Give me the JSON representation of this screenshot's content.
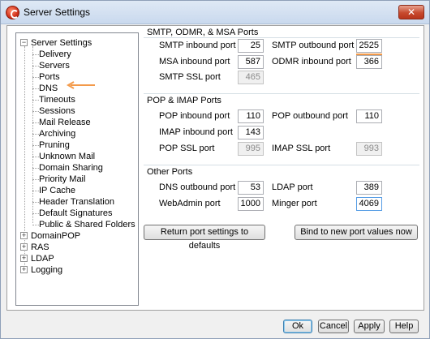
{
  "window": {
    "title": "Server Settings"
  },
  "tree": {
    "items": [
      {
        "label": "Server Settings",
        "level": 0,
        "expander": "−"
      },
      {
        "label": "Delivery",
        "level": 1
      },
      {
        "label": "Servers",
        "level": 1
      },
      {
        "label": "Ports",
        "level": 1
      },
      {
        "label": "DNS",
        "level": 1
      },
      {
        "label": "Timeouts",
        "level": 1
      },
      {
        "label": "Sessions",
        "level": 1
      },
      {
        "label": "Mail Release",
        "level": 1
      },
      {
        "label": "Archiving",
        "level": 1
      },
      {
        "label": "Pruning",
        "level": 1
      },
      {
        "label": "Unknown Mail",
        "level": 1
      },
      {
        "label": "Domain Sharing",
        "level": 1
      },
      {
        "label": "Priority Mail",
        "level": 1
      },
      {
        "label": "IP Cache",
        "level": 1
      },
      {
        "label": "Header Translation",
        "level": 1
      },
      {
        "label": "Default Signatures",
        "level": 1
      },
      {
        "label": "Public & Shared Folders",
        "level": 1
      },
      {
        "label": "DomainPOP",
        "level": 0,
        "expander": "+"
      },
      {
        "label": "RAS",
        "level": 0,
        "expander": "+"
      },
      {
        "label": "LDAP",
        "level": 0,
        "expander": "+"
      },
      {
        "label": "Logging",
        "level": 0,
        "expander": "+"
      }
    ]
  },
  "smtp_group": {
    "title": "SMTP, ODMR, & MSA Ports",
    "smtp_inbound_label": "SMTP inbound port",
    "smtp_inbound_value": "25",
    "smtp_outbound_label": "SMTP outbound port",
    "smtp_outbound_value": "2525",
    "msa_inbound_label": "MSA inbound port",
    "msa_inbound_value": "587",
    "odmr_inbound_label": "ODMR inbound port",
    "odmr_inbound_value": "366",
    "smtp_ssl_label": "SMTP SSL port",
    "smtp_ssl_value": "465"
  },
  "pop_group": {
    "title": "POP & IMAP Ports",
    "pop_inbound_label": "POP inbound port",
    "pop_inbound_value": "110",
    "pop_outbound_label": "POP outbound port",
    "pop_outbound_value": "110",
    "imap_inbound_label": "IMAP inbound port",
    "imap_inbound_value": "143",
    "pop_ssl_label": "POP SSL port",
    "pop_ssl_value": "995",
    "imap_ssl_label": "IMAP SSL port",
    "imap_ssl_value": "993"
  },
  "other_group": {
    "title": "Other Ports",
    "dns_outbound_label": "DNS outbound port",
    "dns_outbound_value": "53",
    "ldap_label": "LDAP port",
    "ldap_value": "389",
    "webadmin_label": "WebAdmin port",
    "webadmin_value": "1000",
    "minger_label": "Minger port",
    "minger_value": "4069"
  },
  "actions": {
    "return_defaults_label": "Return port settings to defaults",
    "bind_new_label": "Bind to new port values now"
  },
  "footer": {
    "ok_label": "Ok",
    "cancel_label": "Cancel",
    "apply_label": "Apply",
    "help_label": "Help"
  },
  "colors": {
    "accent_arrow": "#f39a4a",
    "close_button": "#c74a2e"
  }
}
